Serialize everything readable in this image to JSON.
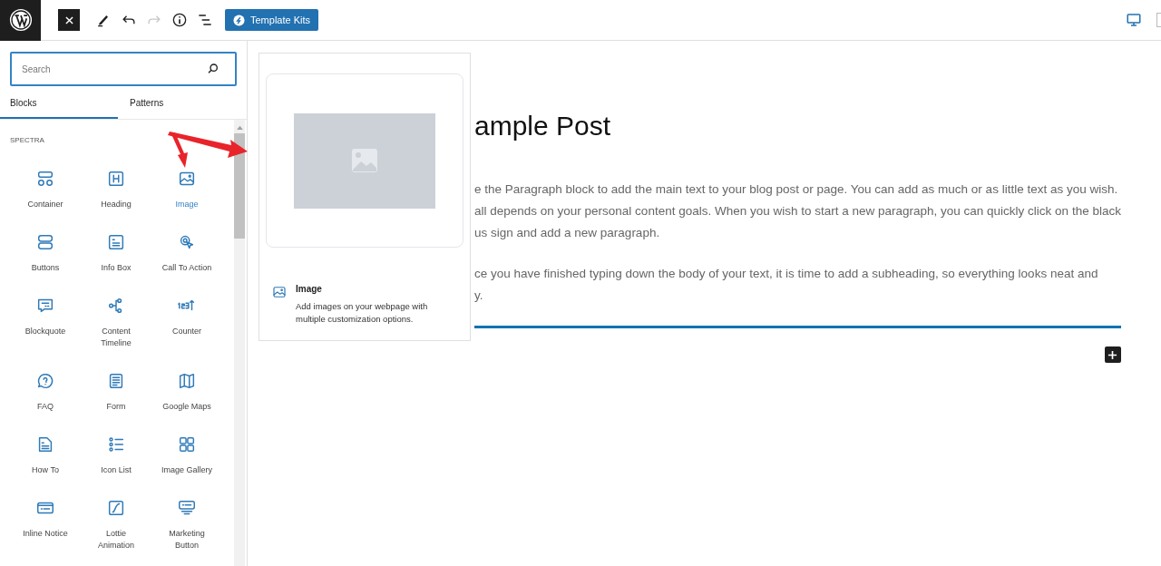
{
  "toolbar": {
    "redo": {
      "disabled": true
    },
    "template_kits": "Template Kits"
  },
  "sidebar": {
    "search": {
      "placeholder": "Search"
    },
    "tabs": [
      {
        "label": "Blocks",
        "selected": true
      },
      {
        "label": "Patterns",
        "selected": false
      }
    ],
    "category": "SPECTRA",
    "blocks": [
      {
        "label": "Container",
        "selected": false
      },
      {
        "label": "Heading",
        "selected": false
      },
      {
        "label": "Image",
        "selected": true
      },
      {
        "label": "Buttons",
        "selected": false
      },
      {
        "label": "Info Box",
        "selected": false
      },
      {
        "label": "Call To Action",
        "selected": false
      },
      {
        "label": "Blockquote",
        "selected": false
      },
      {
        "label": "Content Timeline",
        "selected": false
      },
      {
        "label": "Counter",
        "selected": false
      },
      {
        "label": "FAQ",
        "selected": false
      },
      {
        "label": "Form",
        "selected": false
      },
      {
        "label": "Google Maps",
        "selected": false
      },
      {
        "label": "How To",
        "selected": false
      },
      {
        "label": "Icon List",
        "selected": false
      },
      {
        "label": "Image Gallery",
        "selected": false
      },
      {
        "label": "Inline Notice",
        "selected": false
      },
      {
        "label": "Lottie Animation",
        "selected": false
      },
      {
        "label": "Marketing Button",
        "selected": false
      }
    ]
  },
  "preview": {
    "title": "Image",
    "description": "Add images on your webpage with multiple customization options."
  },
  "post": {
    "title": "ample Post",
    "paragraphs": [
      [
        "e the Paragraph block to add the main text to your blog post or page. You can add as much or as little text as you wish.",
        "all depends on your personal content goals. When you wish to start a new paragraph, you can quickly click on the black",
        "us sign and add a new paragraph."
      ],
      [
        "ce you have finished typing down the body of your text, it is time to add a subheading, so everything looks neat and",
        "y."
      ]
    ]
  }
}
